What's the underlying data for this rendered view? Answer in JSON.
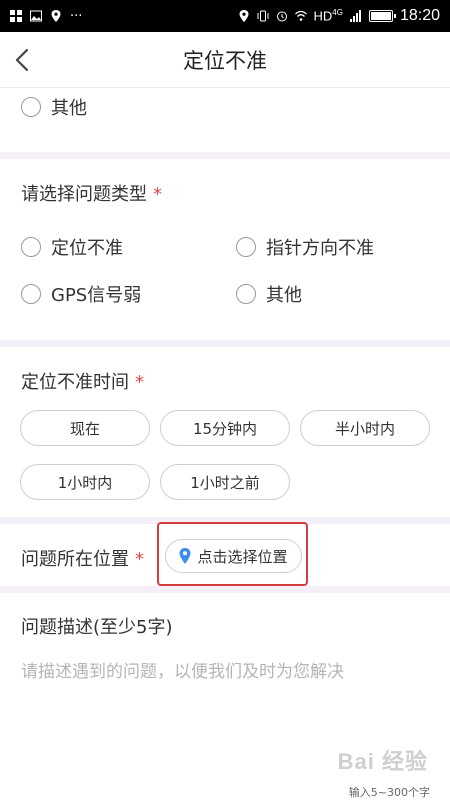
{
  "status_bar": {
    "time": "18:20",
    "network": "HD",
    "network_sub": "4G",
    "battery_level": 0.9,
    "left_icons": [
      "grid-icon",
      "image-icon",
      "location-icon",
      "more-dots-icon"
    ],
    "right_icons": [
      "location-icon",
      "vibrate-icon",
      "alarm-icon",
      "wifi-icon",
      "signal-icon",
      "battery-icon"
    ],
    "more_dots": "···"
  },
  "header": {
    "title": "定位不准"
  },
  "top_section": {
    "option": "其他"
  },
  "problem_type": {
    "label": "请选择问题类型",
    "required": "*",
    "options": [
      "定位不准",
      "指针方向不准",
      "GPS信号弱",
      "其他"
    ]
  },
  "time_section": {
    "label": "定位不准时间",
    "required": "*",
    "chips": [
      "现在",
      "15分钟内",
      "半小时内",
      "1小时内",
      "1小时之前"
    ]
  },
  "location_section": {
    "label": "问题所在位置",
    "required": "*",
    "button": "点击选择位置"
  },
  "description": {
    "label": "问题描述(至少5字)",
    "placeholder": "请描述遇到的问题，以便我们及时为您解决",
    "counter": "输入5~300个字"
  },
  "watermark": "Bai 经验",
  "colors": {
    "accent_required": "#e04a4a",
    "highlight": "#d43d3d",
    "pin": "#3a8ef0"
  }
}
